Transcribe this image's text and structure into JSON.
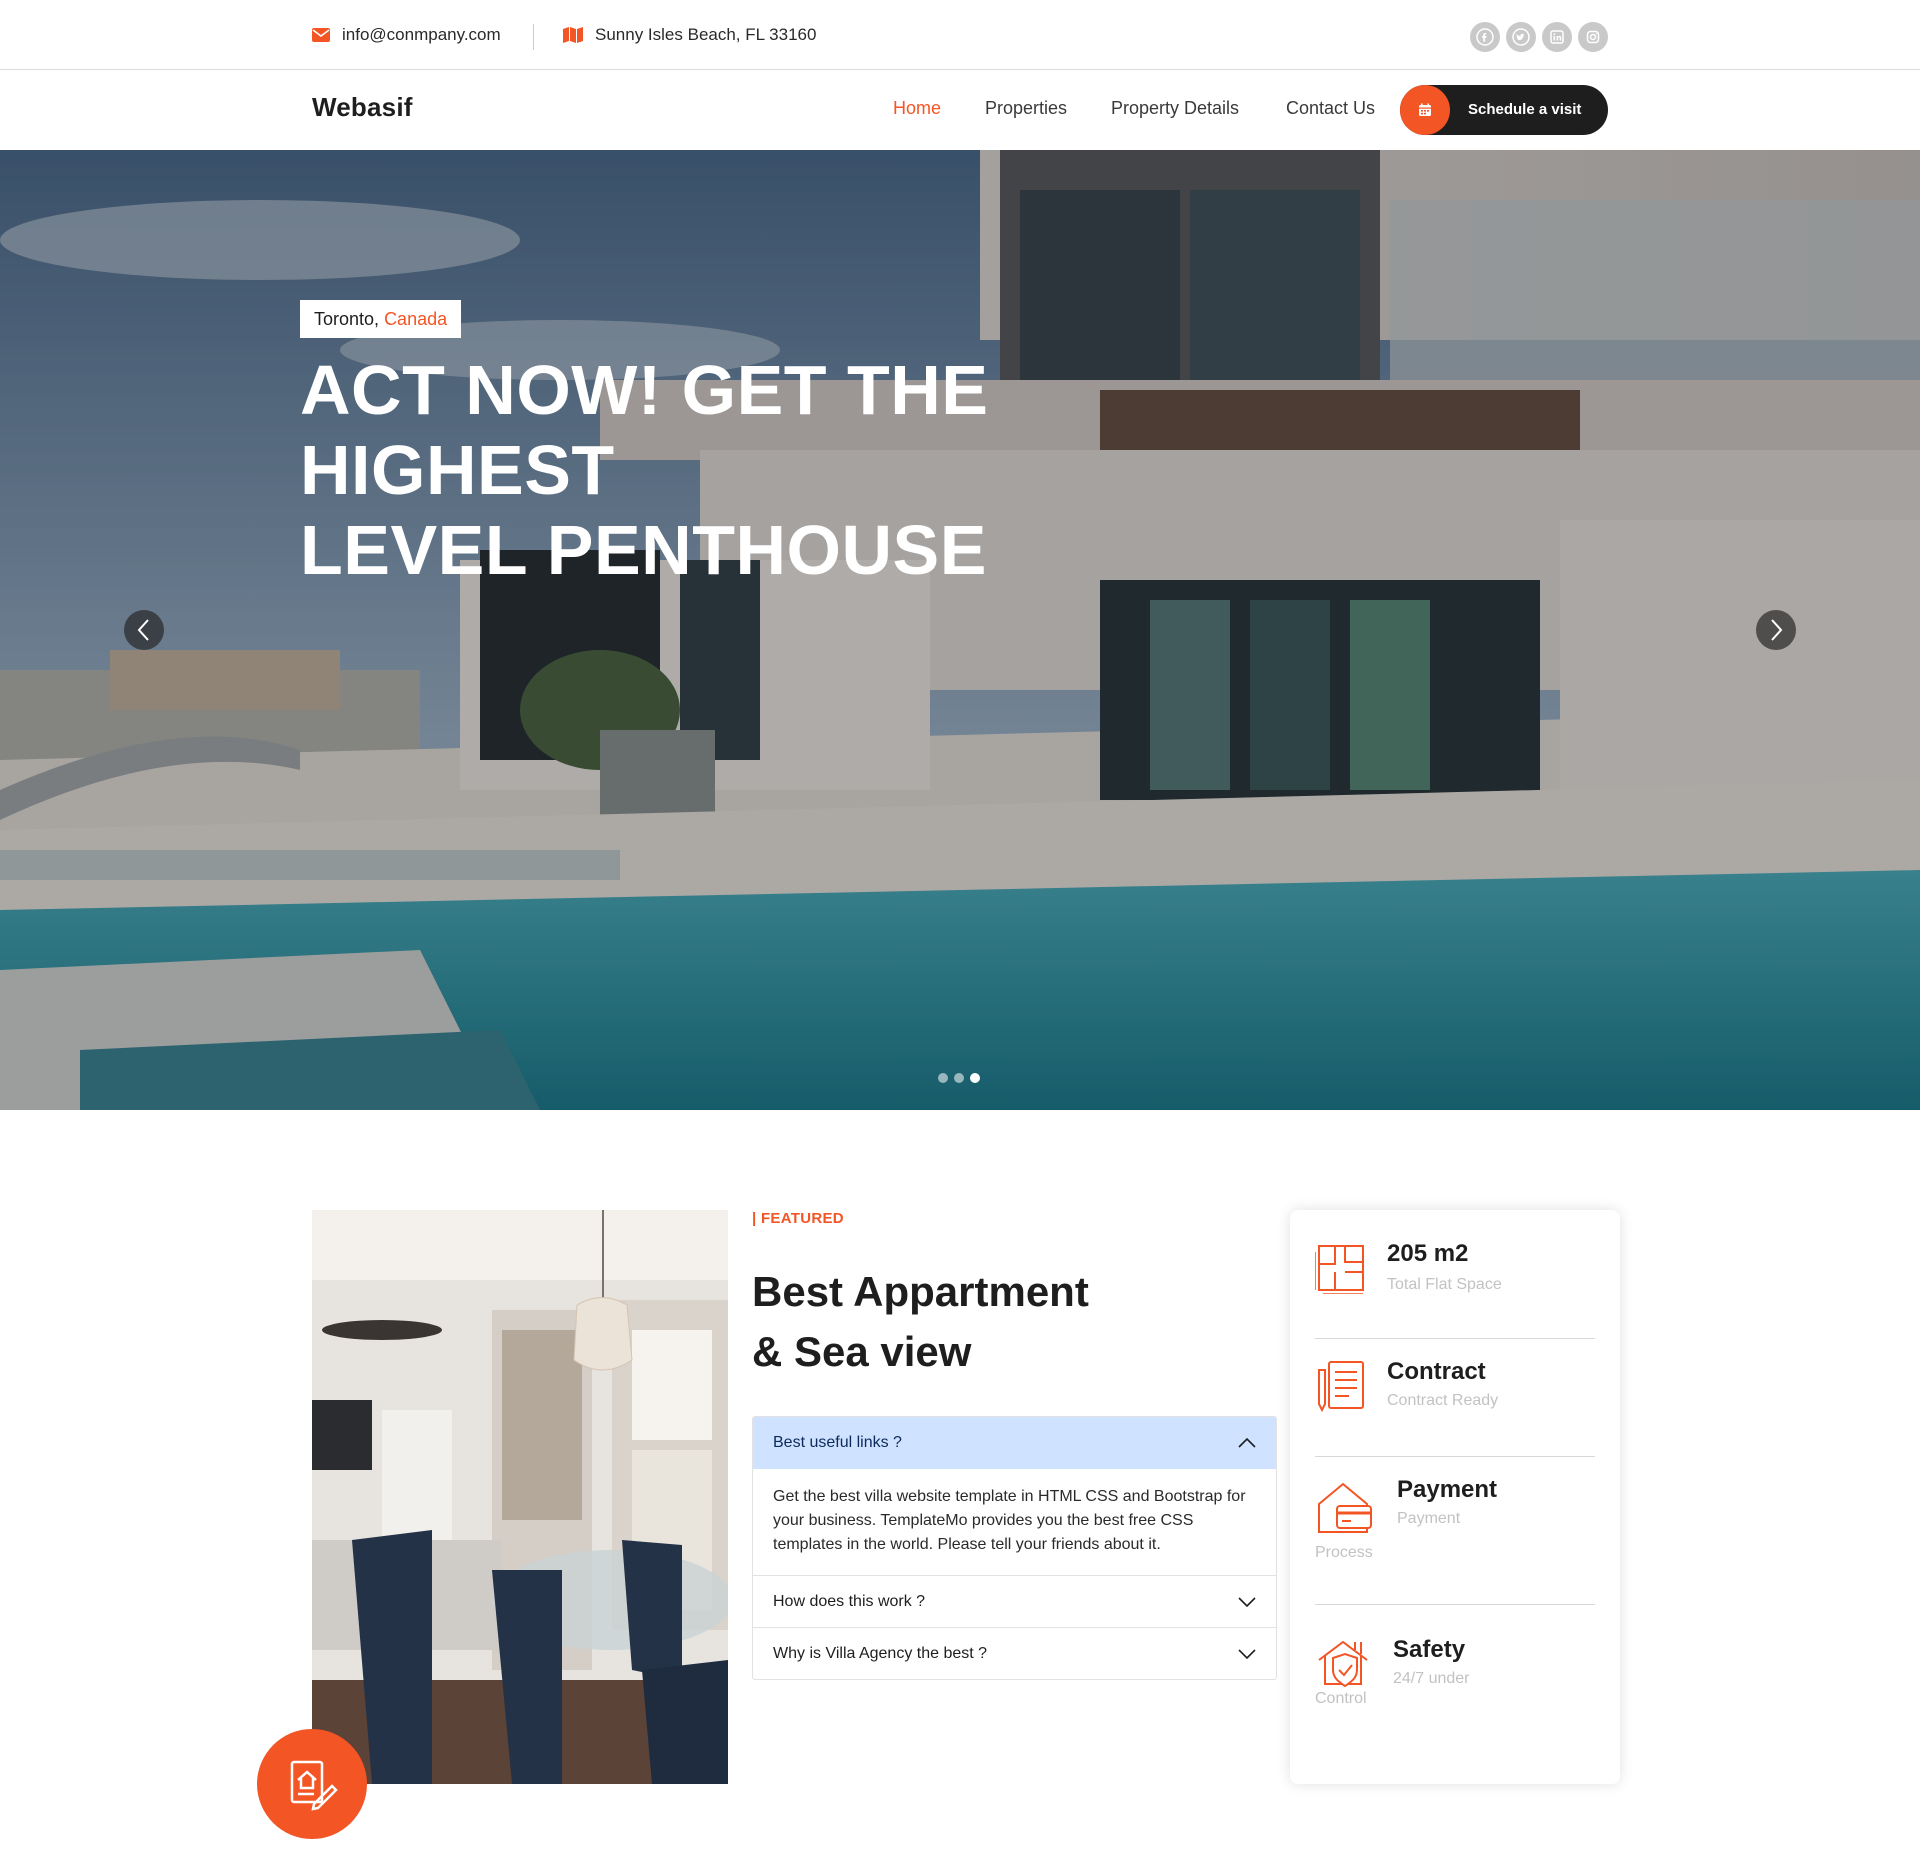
{
  "topbar": {
    "email": "info@conmpany.com",
    "address": "Sunny Isles Beach, FL 33160",
    "socials": [
      "facebook-icon",
      "twitter-icon",
      "linkedin-icon",
      "instagram-icon"
    ]
  },
  "nav": {
    "logo": "Webasif",
    "links": [
      "Home",
      "Properties",
      "Property Details",
      "Contact Us"
    ],
    "active": "Home",
    "cta": "Schedule a visit"
  },
  "hero": {
    "city": "Toronto,",
    "country": "Canada",
    "title_line1": "ACT NOW! GET THE HIGHEST",
    "title_line2": "LEVEL PENTHOUSE",
    "slides": 3,
    "active_slide": 3
  },
  "featured": {
    "label": "| FEATURED",
    "title_line1": "Best Appartment",
    "title_line2": "& Sea view",
    "accordion": [
      {
        "question": "Best useful links ?",
        "open": true,
        "answer": "Get the best villa website template in HTML CSS and Bootstrap for your business. TemplateMo provides you the best free CSS templates in the world. Please tell your friends about it."
      },
      {
        "question": "How does this work ?",
        "open": false
      },
      {
        "question": "Why is Villa Agency the best ?",
        "open": false
      }
    ]
  },
  "info": [
    {
      "title": "205 m2",
      "sub": "Total Flat Space",
      "icon": "floorplan-icon"
    },
    {
      "title": "Contract",
      "sub": "Contract Ready",
      "icon": "contract-icon"
    },
    {
      "title": "Payment",
      "sub": "Payment",
      "extra": "Process",
      "icon": "payment-icon"
    },
    {
      "title": "Safety",
      "sub": "24/7 under",
      "extra": "Control",
      "icon": "safety-icon"
    }
  ],
  "colors": {
    "accent": "#f35525",
    "dark": "#1e1e1e",
    "accordion_open": "#cfe2ff"
  }
}
